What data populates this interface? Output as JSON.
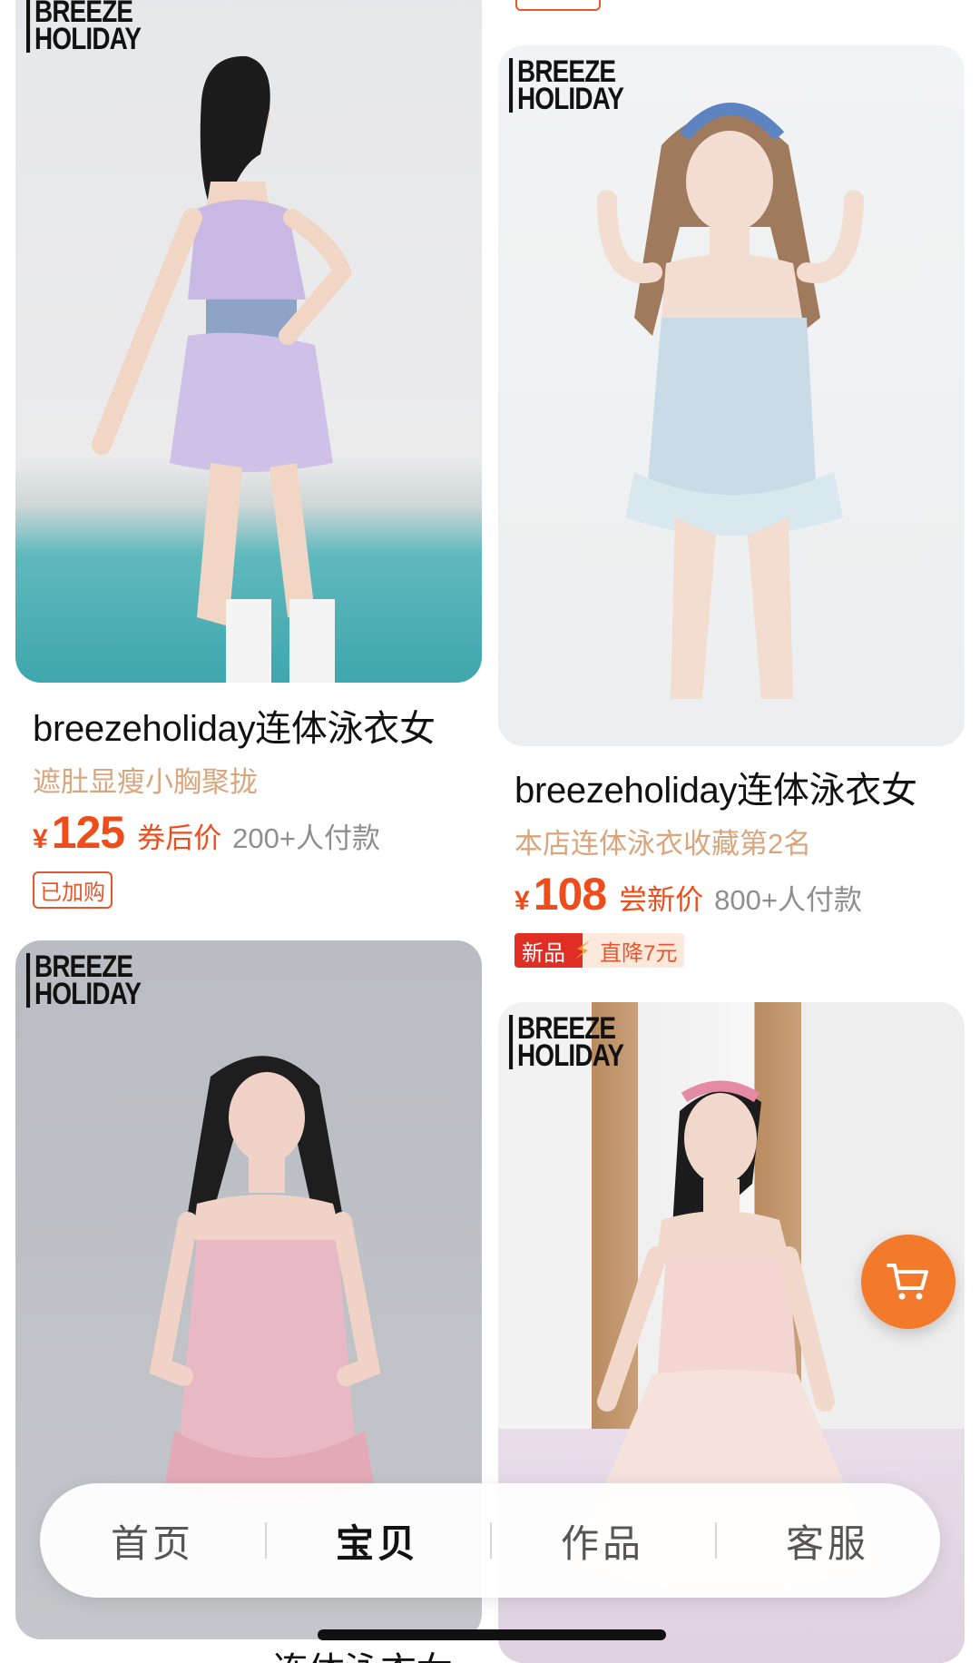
{
  "brand_logo": [
    "BREEZE",
    "HOLIDAY"
  ],
  "products": [
    {
      "title": "breezeholiday连体泳衣女",
      "subtitle": "遮肚显瘦小胸聚拢",
      "currency": "¥",
      "price": "125",
      "price_tag": "券后价",
      "paid_count": "200+人付款",
      "badge": "已加购",
      "garment_color": "#c9b8e3"
    },
    {
      "title": "breezeholiday连体泳衣女",
      "subtitle": "本店连体泳衣收藏第2名",
      "currency": "¥",
      "price": "108",
      "price_tag": "尝新价",
      "paid_count": "800+人付款",
      "badge_new": "新品",
      "badge_drop": "直降7元",
      "garment_color": "#c8dbe6"
    },
    {
      "title": "连体泳衣女",
      "garment_color": "#e8b9c4"
    },
    {
      "garment_color": "#f3d6d1"
    }
  ],
  "tabs": [
    {
      "label": "首页",
      "active": false
    },
    {
      "label": "宝贝",
      "active": true
    },
    {
      "label": "作品",
      "active": false
    },
    {
      "label": "客服",
      "active": false
    }
  ],
  "colors": {
    "accent": "#ee4d1b",
    "subtitle": "#d9a57c",
    "cart_fab": "#f37a2a"
  },
  "icons": [
    "shopping-cart-icon",
    "lightning-icon"
  ]
}
